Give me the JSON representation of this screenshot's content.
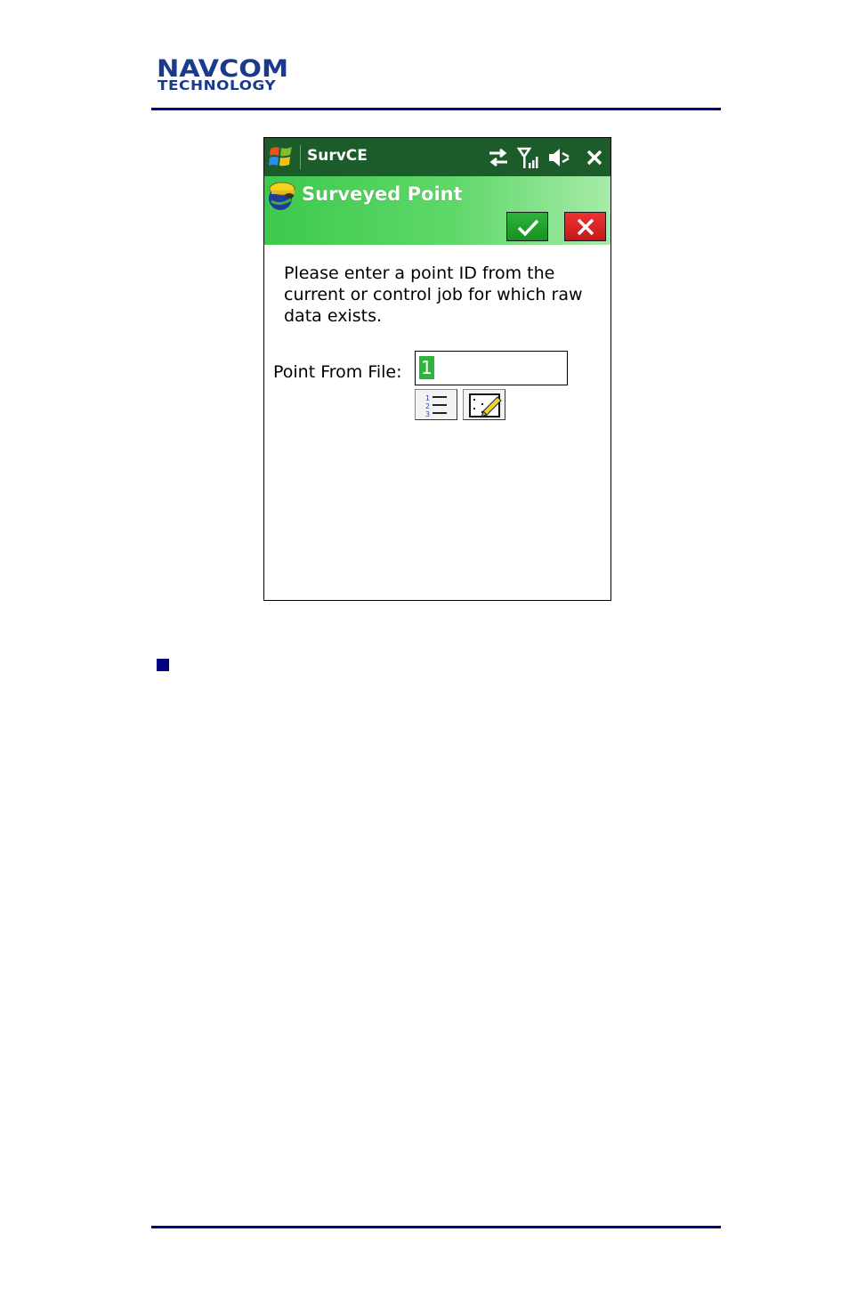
{
  "document": {
    "logo_line1": "NAVCOM",
    "logo_line2": "TECHNOLOGY"
  },
  "titlebar": {
    "app_title": "SurvCE",
    "icons": [
      "windows-start-icon",
      "sync-arrows-icon",
      "signal-antenna-icon",
      "speaker-muted-icon",
      "close-icon"
    ]
  },
  "header": {
    "title": "Surveyed Point",
    "icon": "surveyor-helmet-icon",
    "ok_icon": "checkmark-icon",
    "cancel_icon": "x-mark-icon"
  },
  "form": {
    "instruction": "Please enter a point ID from the current or control job for which raw data exists.",
    "point_label": "Point From File:",
    "point_value": "1",
    "list_button_icon": "numbered-list-icon",
    "map_button_icon": "map-pick-icon"
  },
  "colors": {
    "brand_blue": "#000080",
    "titlebar_green": "#1b5c2a",
    "header_green": "#3dc94c",
    "ok_green": "#2fb33d",
    "cancel_red": "#d42020"
  }
}
